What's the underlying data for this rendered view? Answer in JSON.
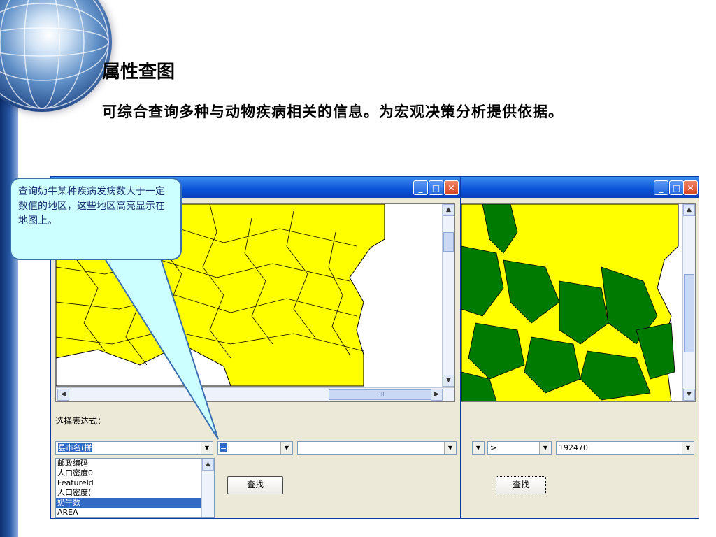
{
  "slide": {
    "title": "属性查图",
    "subtitle": "可综合查询多种与动物疾病相关的信息。为宏观决策分析提供依据。"
  },
  "callout": {
    "text": "查询奶牛某种疾病发病数大于一定数值的地区，这些地区高亮显示在地图上。"
  },
  "window_left": {
    "expression_label": "选择表达式：",
    "field_combo_value": "县市名(拼",
    "operator_combo_value": "=",
    "value_combo_value": "",
    "field_list": [
      "邮政编码",
      "人口密度0",
      "FeatureId",
      "人口密度(",
      "奶牛数",
      "AREA"
    ],
    "field_list_selected": "奶牛数",
    "query_button": "查找",
    "scroll_mark": "III"
  },
  "window_right": {
    "operator_combo_value": ">",
    "value_combo_value": "192470",
    "query_button": "查找"
  },
  "colors": {
    "map_fill_default": "#ffff00",
    "map_fill_highlight": "#007a00",
    "titlebar": "#0b52d8",
    "callout_bg": "#ccffff"
  }
}
